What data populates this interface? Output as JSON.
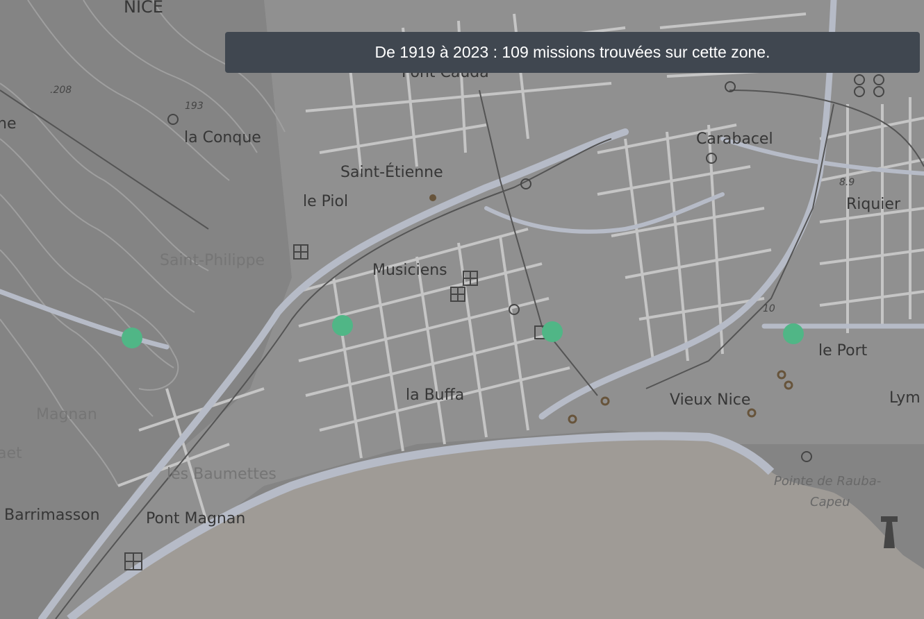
{
  "banner": {
    "text": "De 1919 à 2023 : 109 missions trouvées sur cette zone."
  },
  "colors": {
    "land": "#8d8d8d",
    "sea": "#a9a5a0",
    "marker": "#55c28f",
    "banner_bg": "#404750"
  },
  "labels": {
    "nice": "NICE",
    "ne": "ne",
    "la_conque": "la Conque",
    "saint_etienne": "Saint-Étienne",
    "le_piol": "le Piol",
    "saint_philippe": "Saint-Philippe",
    "musiciens": "Musiciens",
    "carabacel": "Carabacel",
    "riquier": "Riquier",
    "la_buffa": "la Buffa",
    "vieux_nice": "Vieux Nice",
    "le_port": "le Port",
    "lym": "Lym",
    "magnan": "Magnan",
    "aet": "aet",
    "les_baumettes": "les Baumettes",
    "barrimasson": "Barrimasson",
    "pont_magnan": "Pont Magnan",
    "pont_cauda": "Pont Cauda",
    "rauba_1": "Pointe de Rauba-",
    "rauba_2": "Capeu",
    "alt_208": ".208",
    "alt_193": "193",
    "alt_89": "8.9",
    "alt_10": "10"
  },
  "markers": [
    {
      "name": "mission-marker-west"
    },
    {
      "name": "mission-marker-buffa-north"
    },
    {
      "name": "mission-marker-center"
    },
    {
      "name": "mission-marker-port"
    }
  ]
}
